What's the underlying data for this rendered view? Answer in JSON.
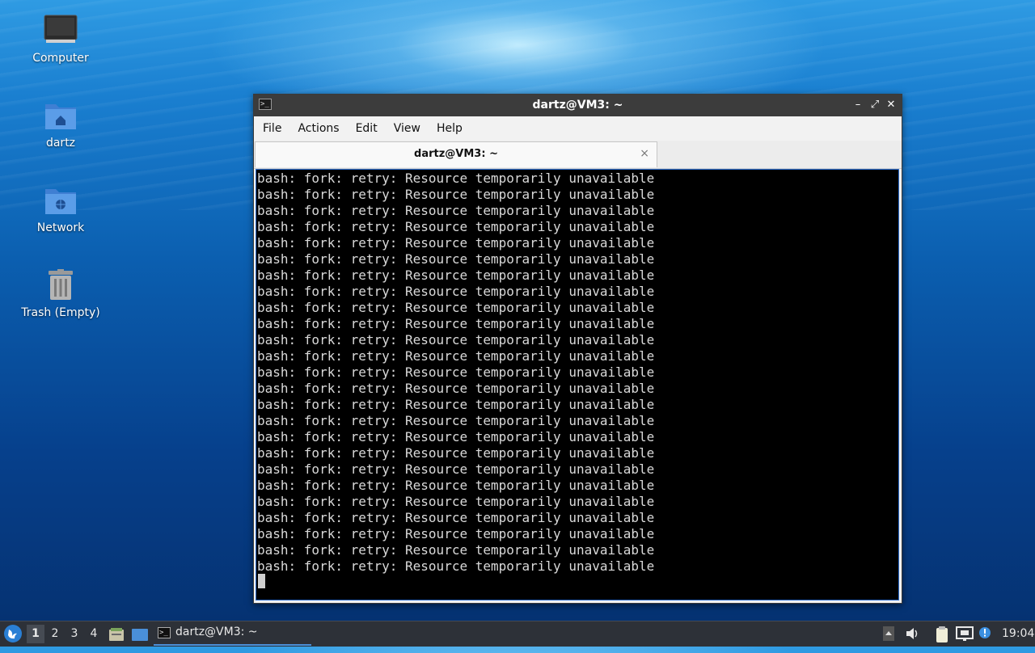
{
  "desktop": {
    "icons": [
      {
        "label": "Computer",
        "icon": "computer-icon"
      },
      {
        "label": "dartz",
        "icon": "home-folder-icon"
      },
      {
        "label": "Network",
        "icon": "network-folder-icon"
      },
      {
        "label": "Trash (Empty)",
        "icon": "trash-icon"
      }
    ]
  },
  "window": {
    "title": "dartz@VM3: ~",
    "controls": {
      "minimize": "–",
      "maximize": "⤢",
      "close": "✕"
    },
    "menu": [
      "File",
      "Actions",
      "Edit",
      "View",
      "Help"
    ],
    "tab": {
      "title": "dartz@VM3: ~",
      "close": "×"
    },
    "terminal": {
      "line": "bash: fork: retry: Resource temporarily unavailable",
      "line_count": 25
    }
  },
  "taskbar": {
    "workspaces": [
      "1",
      "2",
      "3",
      "4"
    ],
    "active_workspace": "1",
    "task_label": "dartz@VM3: ~",
    "clock": "19:04"
  },
  "colors": {
    "accent": "#4a90d9",
    "titlebar": "#3c3c3c",
    "terminal_bg": "#000000",
    "terminal_fg": "#d9d9d9",
    "taskbar": "#2d3138"
  }
}
